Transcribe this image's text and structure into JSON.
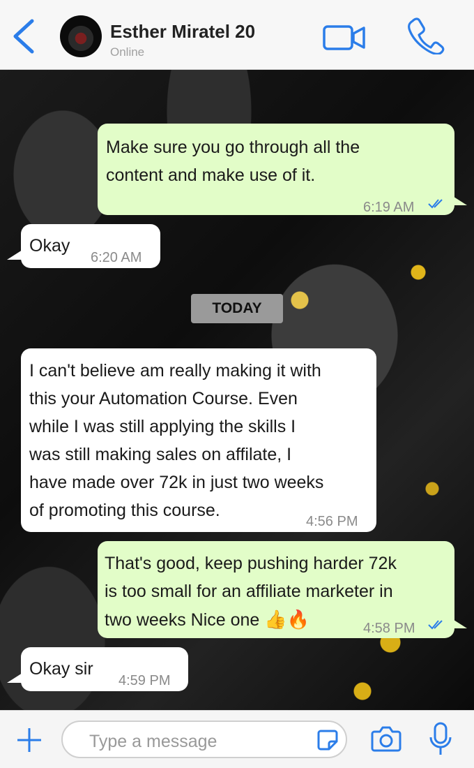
{
  "header": {
    "contact_name": "Esther Miratel 20",
    "status": "Online"
  },
  "colors": {
    "accent": "#2b7de9",
    "outgoing_bubble": "#e2fdc8",
    "incoming_bubble": "#ffffff",
    "read_ticks": "#2b7de9"
  },
  "messages": [
    {
      "direction": "outgoing",
      "text_line1": "Make sure you go through all the",
      "text_line2": "content and make use of it.",
      "time": "6:19 AM",
      "read": true
    },
    {
      "direction": "incoming",
      "text": "Okay",
      "time": "6:20 AM"
    },
    {
      "direction": "incoming",
      "lines": [
        "I can't believe am really making it with",
        "this your Automation Course. Even",
        "while I was still applying the skills I",
        "was still making sales on affilate, I",
        "have made over 72k in just two weeks",
        "of promoting this course."
      ],
      "time": "4:56 PM"
    },
    {
      "direction": "outgoing",
      "lines": [
        "That's good, keep pushing harder 72k",
        "is too small for an affiliate marketer in",
        "two weeks Nice one"
      ],
      "emoji": "👍🔥",
      "time": "4:58 PM",
      "read": true
    },
    {
      "direction": "incoming",
      "text": "Okay sir",
      "time": "4:59 PM"
    }
  ],
  "date_divider": "TODAY",
  "input": {
    "placeholder": "Type a message"
  },
  "icons": {
    "back": "chevron-left-icon",
    "video": "video-camera-icon",
    "call": "phone-icon",
    "attach": "plus-icon",
    "sticker": "sticker-icon",
    "camera": "camera-icon",
    "mic": "microphone-icon"
  }
}
